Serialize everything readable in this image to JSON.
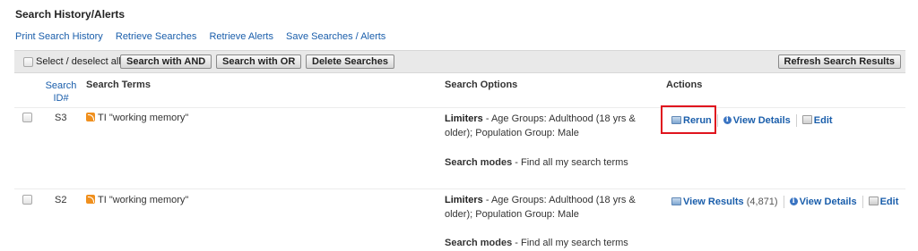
{
  "page_title": "Search History/Alerts",
  "top_links": [
    "Print Search History",
    "Retrieve Searches",
    "Retrieve Alerts",
    "Save Searches / Alerts"
  ],
  "toolbar": {
    "select_label": "Select / deselect all",
    "and_button": "Search with AND",
    "or_button": "Search with OR",
    "delete_button": "Delete Searches",
    "refresh_button": "Refresh Search Results"
  },
  "headers": {
    "search_id": "Search ID#",
    "search_terms": "Search Terms",
    "search_options": "Search Options",
    "actions": "Actions"
  },
  "rows": [
    {
      "id": "S3",
      "term": "TI \"working memory\"",
      "limiters_label": "Limiters",
      "limiters_text": " - Age Groups: Adulthood (18 yrs & older); Population Group: Male",
      "modes_label": "Search modes",
      "modes_text": " - Find all my search terms",
      "rerun": "Rerun",
      "view_details": "View Details",
      "edit": "Edit"
    },
    {
      "id": "S2",
      "term": "TI \"working memory\"",
      "limiters_label": "Limiters",
      "limiters_text": " - Age Groups: Adulthood (18 yrs & older); Population Group: Male",
      "modes_label": "Search modes",
      "modes_text": " - Find all my search terms",
      "view_results": "View Results",
      "results_count": "(4,871)",
      "view_details": "View Details",
      "edit": "Edit"
    }
  ],
  "colors": {
    "link": "#1a5eab",
    "highlight": "#e0141e",
    "toolbar_bg": "#e9e9e9"
  }
}
